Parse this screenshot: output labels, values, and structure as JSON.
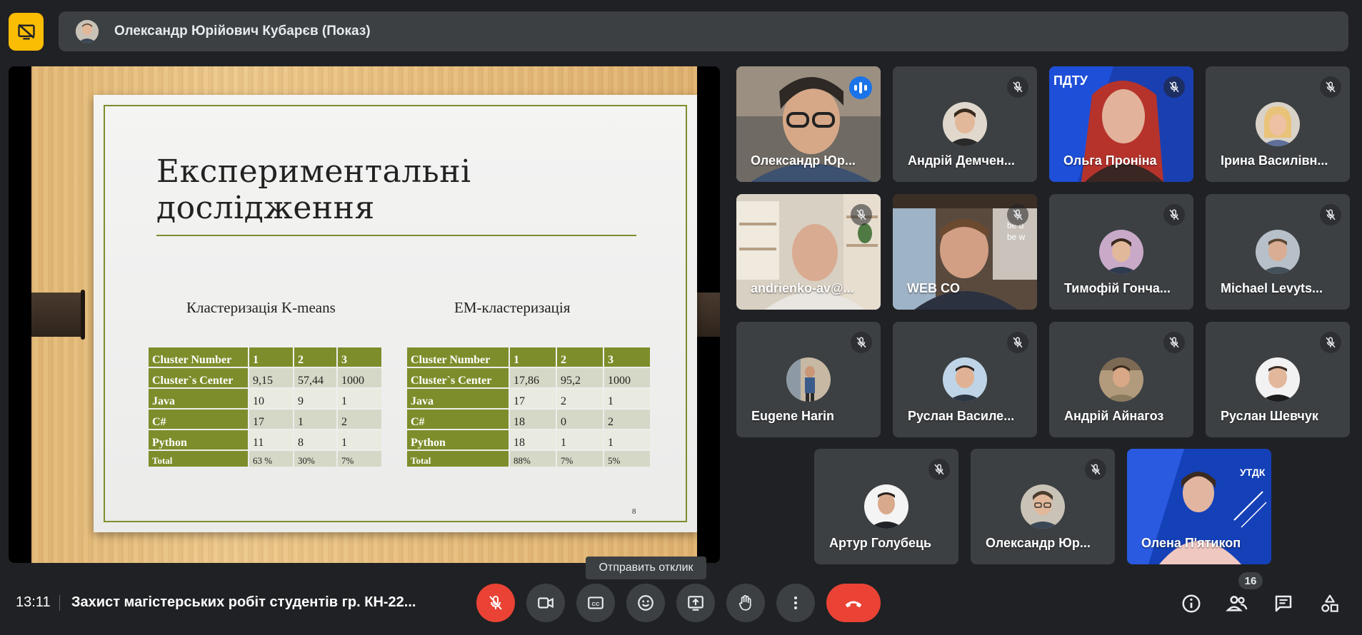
{
  "presenter_bar": {
    "name": "Олександр Юрійович Кубарєв (Показ)"
  },
  "slide": {
    "title": "Експериментальні дослідження",
    "number": "8",
    "tables": [
      {
        "heading": "Кластеризація K-means",
        "columns": [
          "Cluster Number",
          "1",
          "2",
          "3"
        ],
        "rows": [
          [
            "Cluster`s Center",
            "9,15",
            "57,44",
            "1000"
          ],
          [
            "Java",
            "10",
            "9",
            "1"
          ],
          [
            "C#",
            "17",
            "1",
            "2"
          ],
          [
            "Python",
            "11",
            "8",
            "1"
          ],
          [
            "Total",
            "63 %",
            "30%",
            "7%"
          ]
        ]
      },
      {
        "heading": "EM-кластеризація",
        "columns": [
          "Cluster Number",
          "1",
          "2",
          "3"
        ],
        "rows": [
          [
            "Cluster`s Center",
            "17,86",
            "95,2",
            "1000"
          ],
          [
            "Java",
            "17",
            "2",
            "1"
          ],
          [
            "C#",
            "18",
            "0",
            "2"
          ],
          [
            "Python",
            "18",
            "1",
            "1"
          ],
          [
            "Total",
            "88%",
            "7%",
            "5%"
          ]
        ]
      }
    ]
  },
  "participants": [
    {
      "name": "Олександр Юр...",
      "speaking": true
    },
    {
      "name": "Андрій Демчен..."
    },
    {
      "name": "Ольга Проніна"
    },
    {
      "name": "Ірина Василівн..."
    },
    {
      "name": "andrienko-av@..."
    },
    {
      "name": "WEB CO"
    },
    {
      "name": "Тимофій Гонча..."
    },
    {
      "name": "Michael Levyts..."
    },
    {
      "name": "Eugene Harin"
    },
    {
      "name": "Руслан Василе..."
    },
    {
      "name": "Андрій Айнагоз"
    },
    {
      "name": "Руслан Шевчук"
    },
    {
      "name": "Артур Голубець"
    },
    {
      "name": "Олександр Юр..."
    },
    {
      "name": "Олена П'ятикоп"
    }
  ],
  "bottom_bar": {
    "time": "13:11",
    "meeting_title": "Захист магістерських робіт студентів гр. КН-22...",
    "tooltip": "Отправить отклик",
    "participant_count": "16"
  },
  "icons": {
    "stop_presenting": "stop-presenting-icon",
    "mic_off": "mic-off-icon",
    "camera": "camera-icon",
    "captions": "closed-captions-icon",
    "emoji": "emoji-icon",
    "present": "present-screen-icon",
    "raise_hand": "raise-hand-icon",
    "more": "more-vert-icon",
    "end_call": "end-call-icon",
    "info": "info-icon",
    "people": "people-icon",
    "chat": "chat-icon",
    "activities": "activities-icon"
  },
  "colors": {
    "accent_yellow": "#fbbc04",
    "danger_red": "#ea4335",
    "speaking_blue": "#1a73e8",
    "slide_green": "#7e8d2b"
  }
}
